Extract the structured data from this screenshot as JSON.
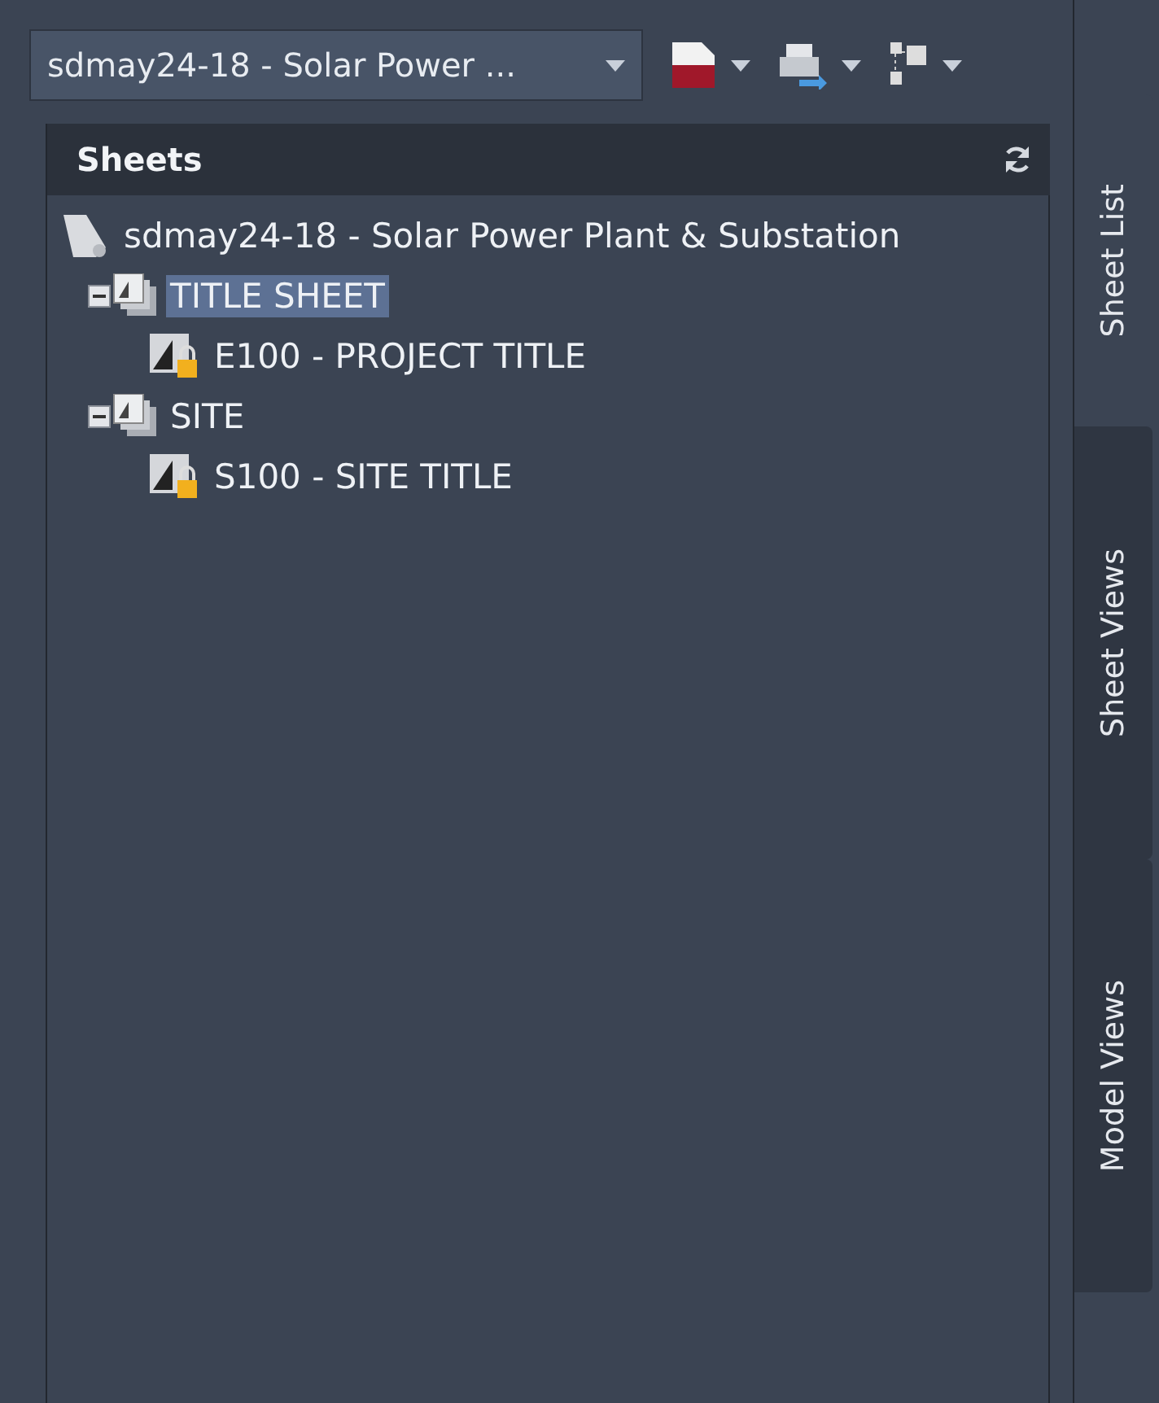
{
  "toolbar": {
    "sheet_set": "sdmay24-18 - Solar Power ..."
  },
  "panel": {
    "title": "Sheets"
  },
  "tree": [
    {
      "label": "sdmay24-18 - Solar Power Plant & Substation",
      "kind": "sheet_set",
      "selected": false,
      "children": [
        {
          "label": "TITLE SHEET",
          "kind": "subset",
          "expanded": true,
          "selected": true,
          "children": [
            {
              "label": "E100 - PROJECT TITLE",
              "kind": "sheet",
              "selected": false
            }
          ]
        },
        {
          "label": "SITE",
          "kind": "subset",
          "expanded": true,
          "selected": false,
          "children": [
            {
              "label": "S100 - SITE TITLE",
              "kind": "sheet",
              "selected": false
            }
          ]
        }
      ]
    }
  ],
  "side_tabs": [
    {
      "label": "Sheet List",
      "selected": true
    },
    {
      "label": "Sheet Views",
      "selected": false
    },
    {
      "label": "Model Views",
      "selected": false
    }
  ]
}
